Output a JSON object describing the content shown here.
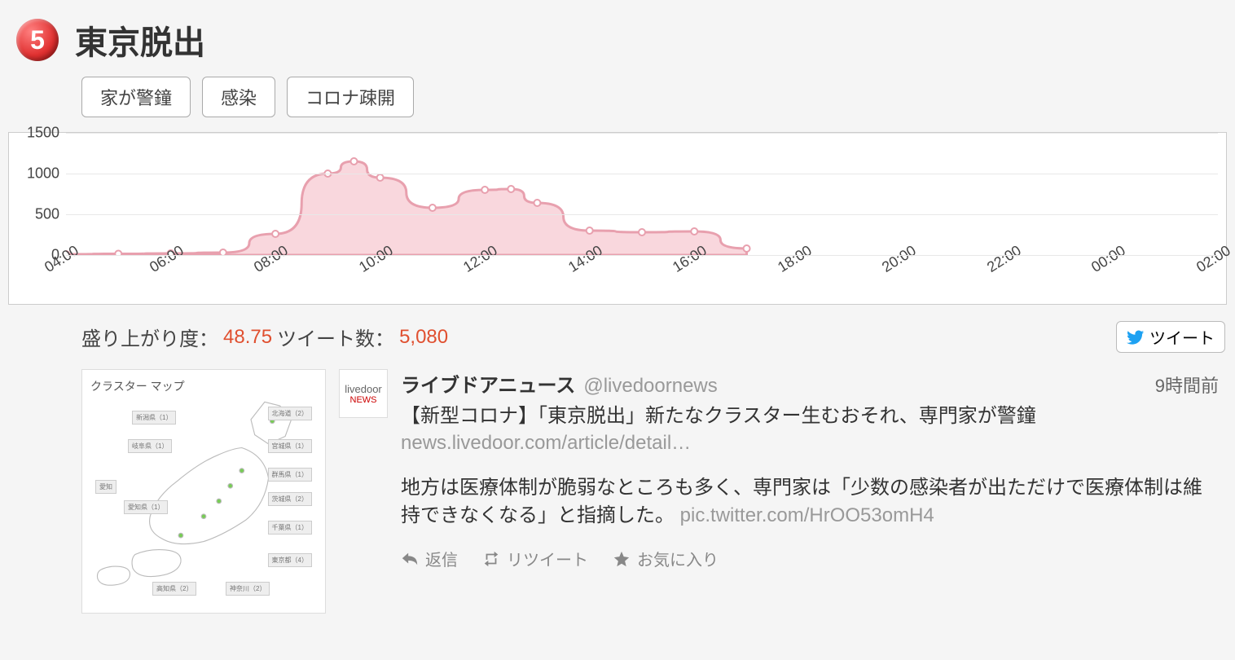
{
  "rank": "5",
  "title": "東京脱出",
  "tags": [
    "家が警鐘",
    "感染",
    "コロナ疎開"
  ],
  "metrics": {
    "buzz_label": "盛り上がり度：",
    "buzz_value": "48.75",
    "tweets_label": " ツイート数：",
    "tweets_value": "5,080"
  },
  "tweet_button": "ツイート",
  "chart_data": {
    "type": "area",
    "title": "",
    "xlabel": "",
    "ylabel": "",
    "ylim": [
      0,
      1500
    ],
    "y_ticks": [
      0,
      500,
      1000,
      1500
    ],
    "categories": [
      "04:00",
      "06:00",
      "08:00",
      "10:00",
      "12:00",
      "14:00",
      "16:00",
      "18:00",
      "20:00",
      "22:00",
      "00:00",
      "02:00"
    ],
    "x": [
      "04:00",
      "05:00",
      "06:00",
      "07:00",
      "08:00",
      "09:00",
      "09:30",
      "10:00",
      "11:00",
      "12:00",
      "12:30",
      "13:00",
      "14:00",
      "15:00",
      "16:00",
      "17:00"
    ],
    "values": [
      10,
      15,
      20,
      30,
      260,
      1000,
      1150,
      950,
      580,
      800,
      810,
      640,
      300,
      280,
      290,
      80
    ]
  },
  "thumbnail": {
    "title": "クラスター マップ"
  },
  "tweet": {
    "avatar_line1": "livedoor",
    "avatar_line2": "NEWS",
    "name": "ライブドアニュース",
    "handle": "@livedoornews",
    "time": "9時間前",
    "headline": "【新型コロナ】「東京脱出」新たなクラスター生むおそれ、専門家が警鐘",
    "url": "news.livedoor.com/article/detail…",
    "body_text": "地方は医療体制が脆弱なところも多く、専門家は「少数の感染者が出ただけで医療体制は維持できなくなる」と指摘した。 ",
    "body_link": "pic.twitter.com/HrOO53omH4",
    "actions": {
      "reply": "返信",
      "retweet": "リツイート",
      "favorite": "お気に入り"
    }
  }
}
